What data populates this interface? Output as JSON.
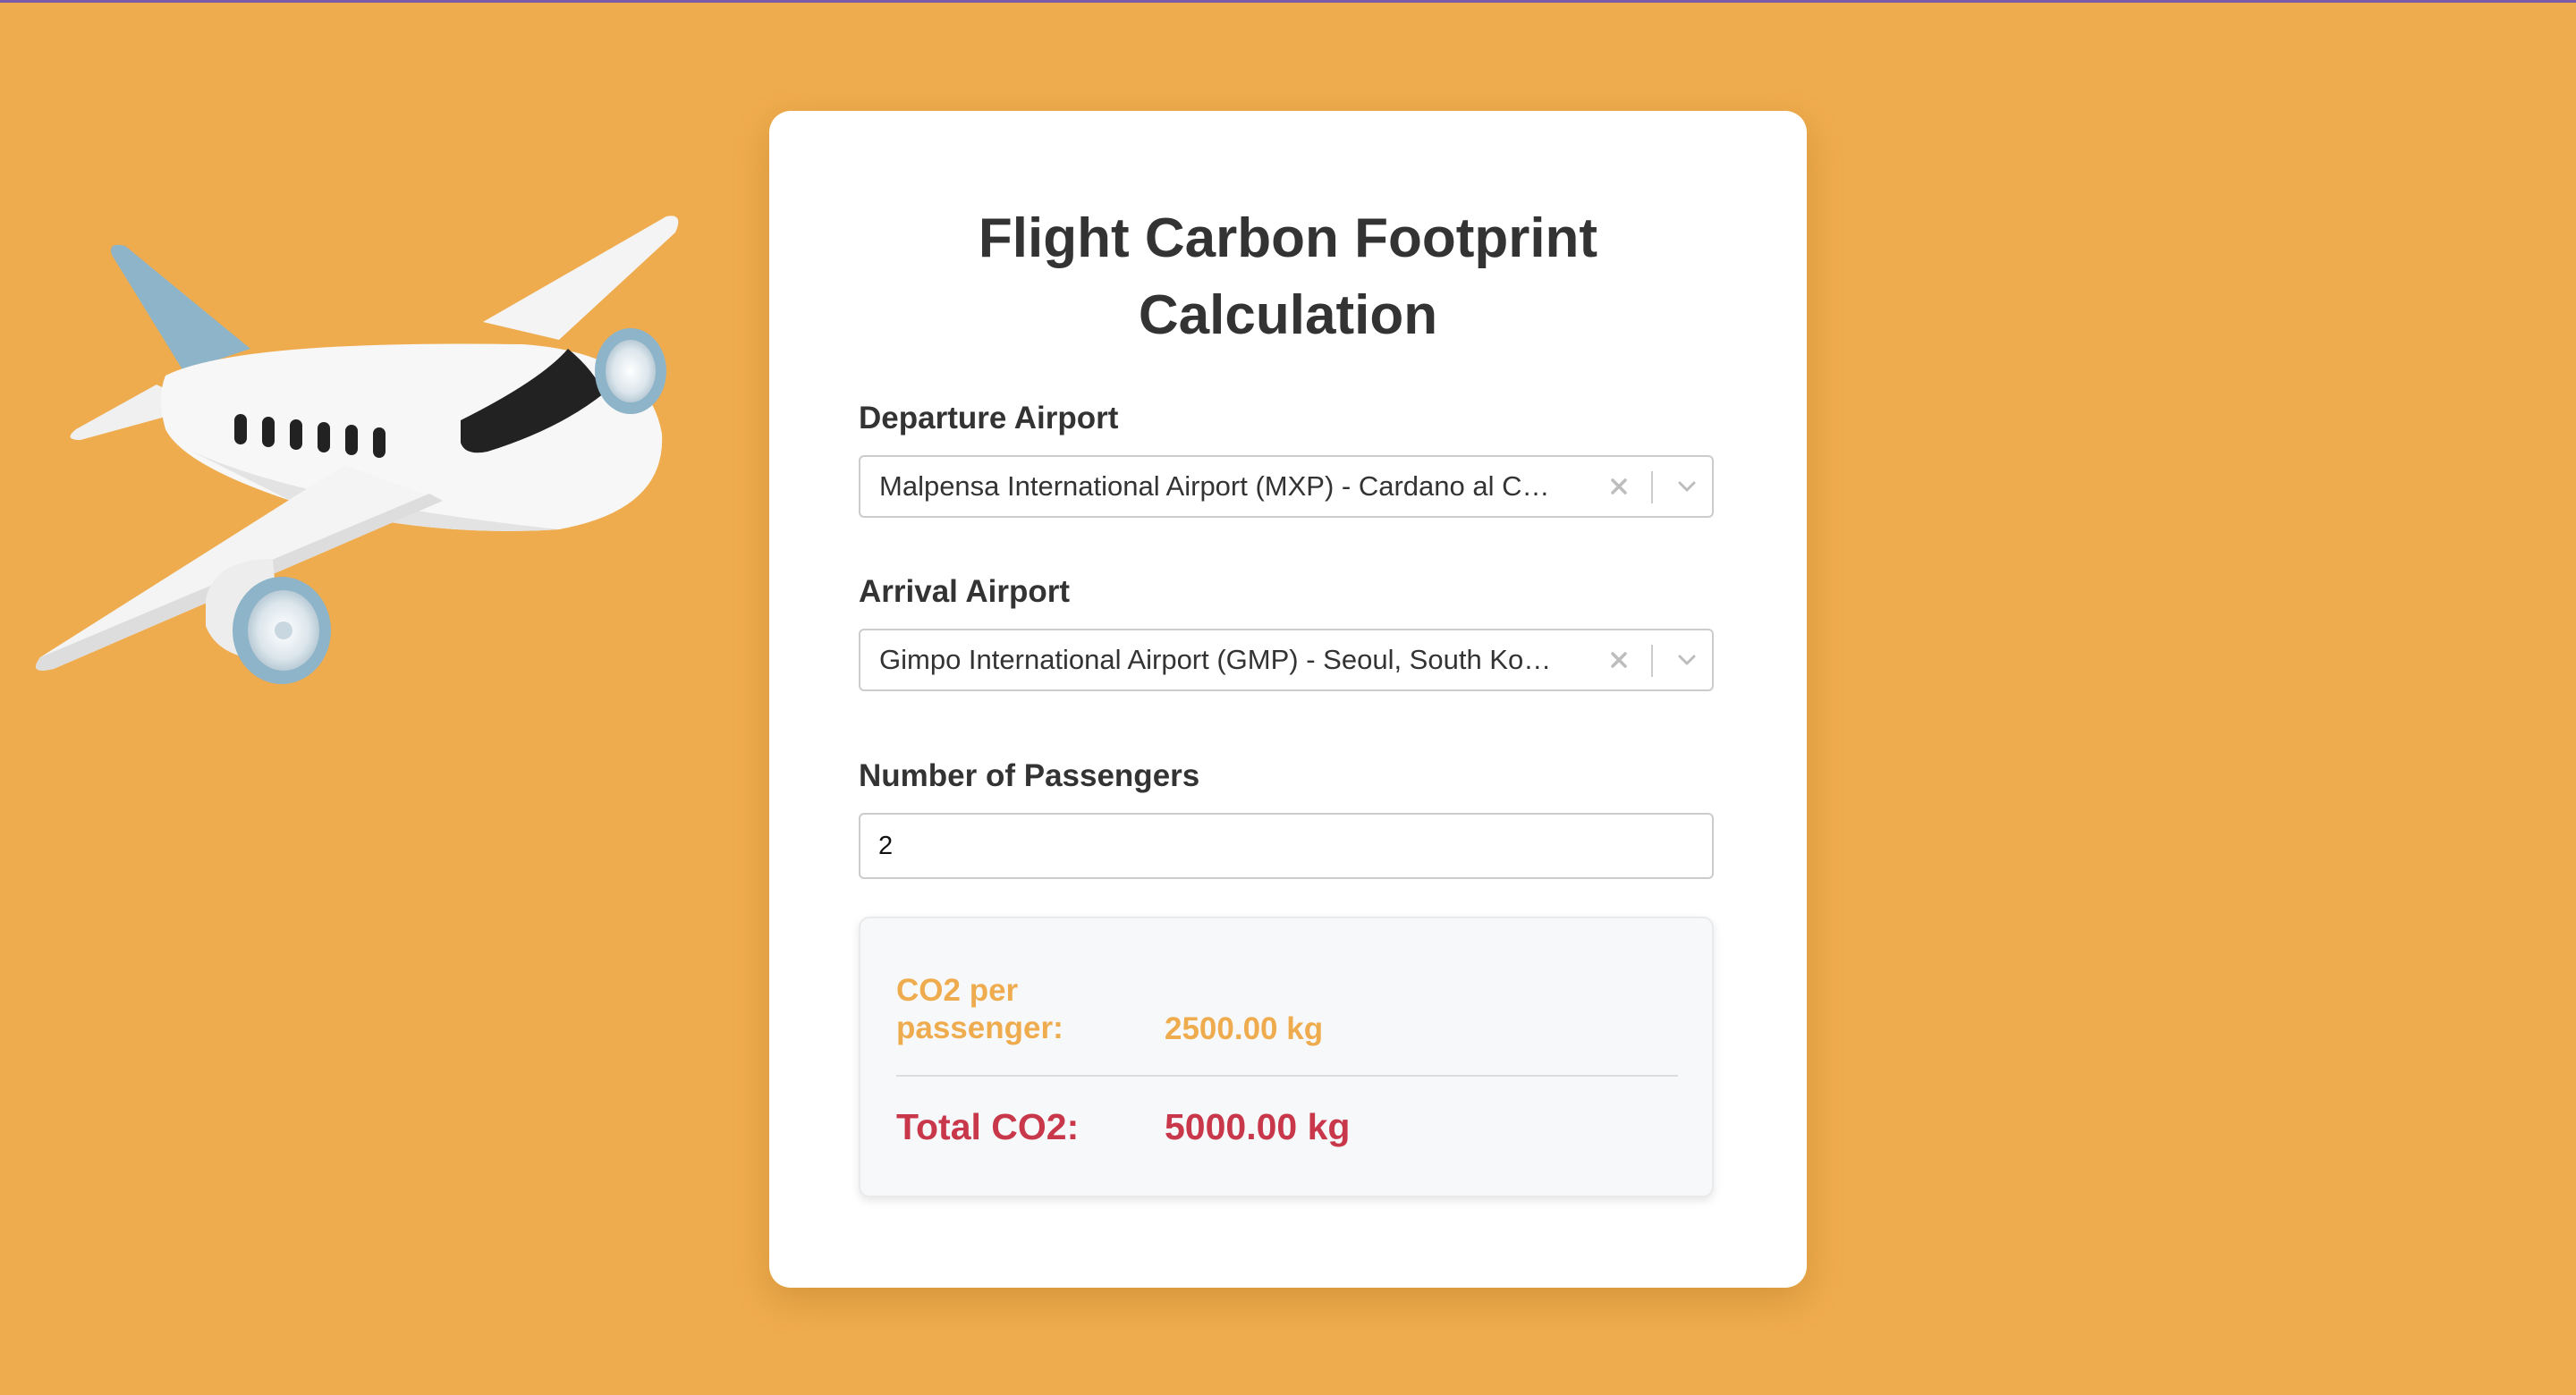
{
  "page": {
    "title_line_1": "Flight Carbon Footprint",
    "title_line_2": "Calculation"
  },
  "departure": {
    "label": "Departure Airport",
    "value": "Malpensa International Airport (MXP) - Cardano al Campo, Italy",
    "clear_icon": "close-icon",
    "dropdown_icon": "chevron-down-icon"
  },
  "arrival": {
    "label": "Arrival Airport",
    "value": "Gimpo International Airport (GMP) - Seoul, South Korea",
    "clear_icon": "close-icon",
    "dropdown_icon": "chevron-down-icon"
  },
  "passengers": {
    "label": "Number of Passengers",
    "value": "2"
  },
  "results": {
    "per_passenger_label": "CO2 per passenger:",
    "per_passenger_value": "2500.00 kg",
    "total_label": "Total CO2:",
    "total_value": "5000.00 kg"
  },
  "illustration": {
    "icon": "airplane-illustration"
  },
  "colors": {
    "background": "#EFAC4E",
    "accent_orange": "#EFAC4E",
    "total_red": "#C8384A",
    "text_dark": "#333333"
  }
}
